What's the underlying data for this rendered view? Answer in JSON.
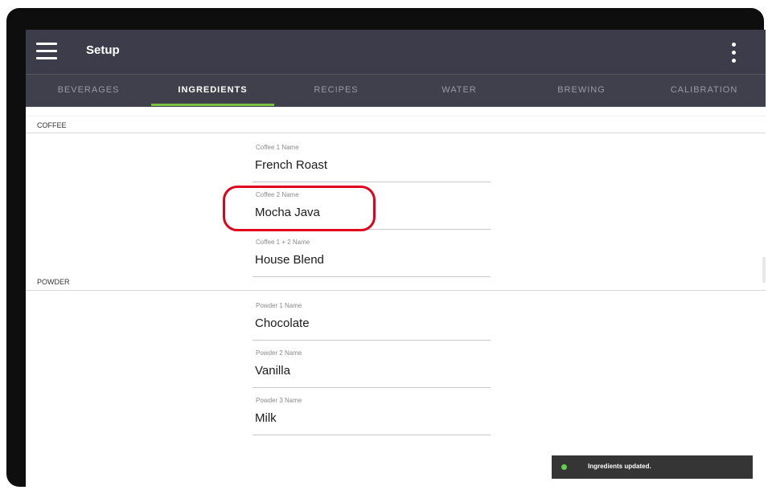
{
  "app": {
    "title": "Setup"
  },
  "header": {
    "menu_icon": "hamburger-icon",
    "overflow_icon": "more-vertical-icon"
  },
  "tabs": [
    {
      "label": "BEVERAGES",
      "active": false
    },
    {
      "label": "INGREDIENTS",
      "active": true
    },
    {
      "label": "RECIPES",
      "active": false
    },
    {
      "label": "WATER",
      "active": false
    },
    {
      "label": "BREWING",
      "active": false
    },
    {
      "label": "CALIBRATION",
      "active": false
    }
  ],
  "sections": {
    "coffee": {
      "title": "COFFEE",
      "fields": [
        {
          "label": "Coffee 1 Name",
          "value": "French Roast"
        },
        {
          "label": "Coffee 2 Name",
          "value": "Mocha Java"
        },
        {
          "label": "Coffee 1 + 2 Name",
          "value": "House Blend"
        }
      ]
    },
    "powder": {
      "title": "POWDER",
      "fields": [
        {
          "label": "Powder 1 Name",
          "value": "Chocolate"
        },
        {
          "label": "Powder 2 Name",
          "value": "Vanilla"
        },
        {
          "label": "Powder 3 Name",
          "value": "Milk"
        }
      ]
    }
  },
  "toast": {
    "message": "Ingredients updated.",
    "status_color": "#5fd14b"
  },
  "colors": {
    "appbar": "#3d3c4a",
    "accent": "#7cc242",
    "highlight": "#e0001b"
  }
}
